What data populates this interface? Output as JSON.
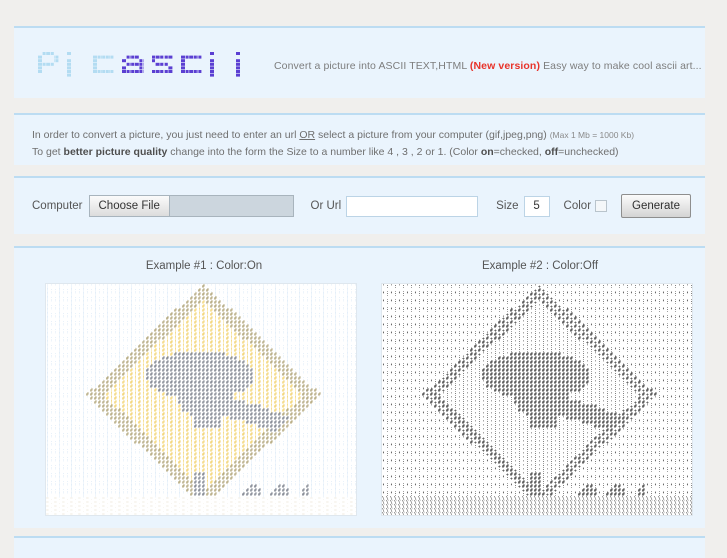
{
  "header": {
    "logo_text": "picascii",
    "logo_part_light": "pic",
    "logo_part_dark": "ascii",
    "logo_color_light": "#b3dcf2",
    "logo_color_dark": "#5b3fd2",
    "tagline_before": "Convert a picture into ASCII TEXT,HTML ",
    "tagline_badge": "(New version)",
    "tagline_after": " Easy way to make cool ascii art..."
  },
  "info": {
    "line1_a": "In order to convert a picture, you just need to enter an url ",
    "line1_or": "OR",
    "line1_b": " select a picture from your computer (gif,jpeg,png) ",
    "line1_max": "(Max 1 Mb = 1000 Kb)",
    "line2_a": "To get ",
    "line2_bold1": "better picture quality",
    "line2_b": " change into the form the Size to a number like 4 , 3 , 2 or 1. (Color ",
    "line2_bold2": "on",
    "line2_c": "=checked, ",
    "line2_bold3": "off",
    "line2_d": "=unchecked)"
  },
  "form": {
    "computer_label": "Computer",
    "choose_file_label": "Choose File",
    "file_name": "",
    "url_label": "Or Url",
    "url_value": "",
    "url_placeholder": "",
    "size_label": "Size",
    "size_value": "5",
    "color_label": "Color",
    "color_checked": false,
    "generate_label": "Generate"
  },
  "examples": {
    "example1_caption": "Example #1 : Color:On",
    "example2_caption": "Example #2 : Color:Off",
    "art_subject": "yellow diamond kangaroo crossing road sign",
    "example1_mode": "color",
    "example2_mode": "monochrome",
    "colors": {
      "sky": "#cfe2f4",
      "sign_yellow": "#edc033",
      "sign_shadow": "#8c7a3a",
      "kangaroo": "#3d4555",
      "ground": "#efe9dd"
    },
    "ascii_charset": "@#+=:,.`'\\ "
  },
  "page": {
    "background": "#f0efed",
    "band_background": "#eaf4fd",
    "band_border": "#bcdcf2"
  }
}
